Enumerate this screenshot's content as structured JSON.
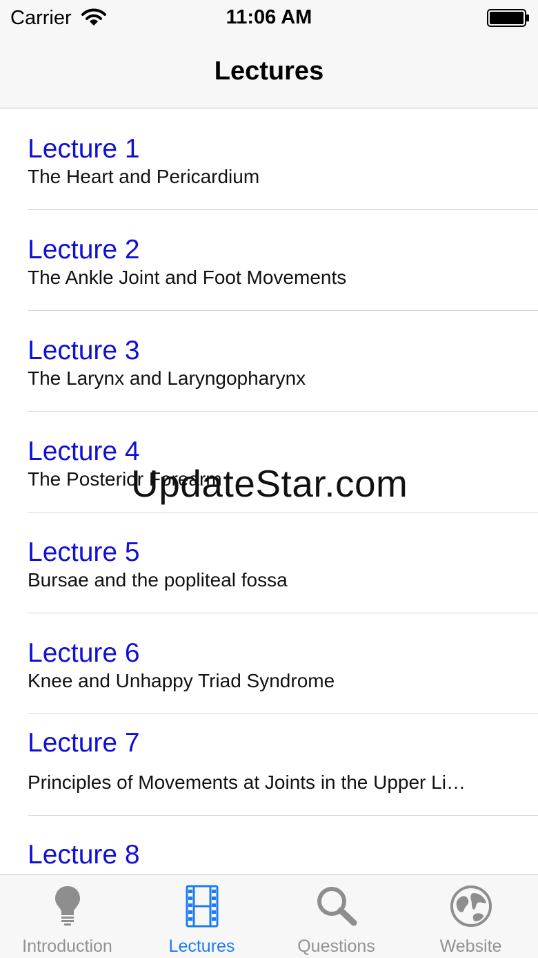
{
  "status_bar": {
    "carrier": "Carrier",
    "time": "11:06 AM",
    "wifi_icon": "wifi-icon",
    "battery_icon": "battery-icon"
  },
  "nav": {
    "title": "Lectures"
  },
  "lectures": [
    {
      "title": "Lecture 1",
      "subtitle": "The Heart and Pericardium"
    },
    {
      "title": "Lecture 2",
      "subtitle": "The Ankle Joint and Foot Movements"
    },
    {
      "title": "Lecture 3",
      "subtitle": "The Larynx and Laryngopharynx"
    },
    {
      "title": "Lecture 4",
      "subtitle": "The Posterior Forearm"
    },
    {
      "title": "Lecture 5",
      "subtitle": "Bursae and the popliteal fossa"
    },
    {
      "title": "Lecture 6",
      "subtitle": "Knee and Unhappy Triad Syndrome"
    },
    {
      "title": "Lecture 7",
      "subtitle": "Principles of Movements at Joints in the Upper Li…"
    },
    {
      "title": "Lecture 8",
      "subtitle": ""
    }
  ],
  "watermark": "UpdateStar.com",
  "tabs": [
    {
      "label": "Introduction",
      "icon": "lightbulb-icon",
      "active": false
    },
    {
      "label": "Lectures",
      "icon": "film-icon",
      "active": true
    },
    {
      "label": "Questions",
      "icon": "magnifier-icon",
      "active": false
    },
    {
      "label": "Website",
      "icon": "globe-icon",
      "active": false
    }
  ],
  "colors": {
    "link_blue": "#0f0fd6",
    "tab_active": "#1d7cf2",
    "tab_inactive": "#929292",
    "bar_background": "#f7f7f7"
  }
}
